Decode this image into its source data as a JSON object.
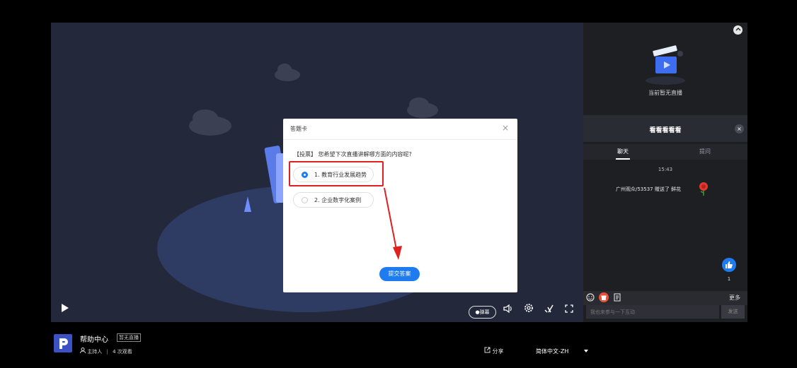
{
  "poll_dialog": {
    "title": "答题卡",
    "close": "×",
    "question": "【投票】 您希望下次直播讲解哪方面的内容呢?",
    "options": [
      {
        "label": "1. 教育行业发展趋势",
        "selected": true
      },
      {
        "label": "2. 企业数字化案例",
        "selected": false
      }
    ],
    "submit": "提交答案"
  },
  "player": {
    "danmaku": "●弹幕"
  },
  "side": {
    "no_live": "当前暂无直播",
    "panel_title": "看看看看看",
    "close": "×",
    "tabs": [
      "聊天",
      "提问"
    ],
    "time": "15:43",
    "gift_message": "广州观众/53537 赠送了 鲜花",
    "likes": "1",
    "more": "更多",
    "input_placeholder": "我也来参与一下互动",
    "send": "发送"
  },
  "channel": {
    "name": "帮助中心",
    "status": "暂无直播",
    "host": "主持人",
    "views": "4 次观看",
    "share": "分享",
    "language": "简体中文-ZH"
  },
  "colors": {
    "accent": "#1e7cf0",
    "highlight": "#e02020"
  }
}
